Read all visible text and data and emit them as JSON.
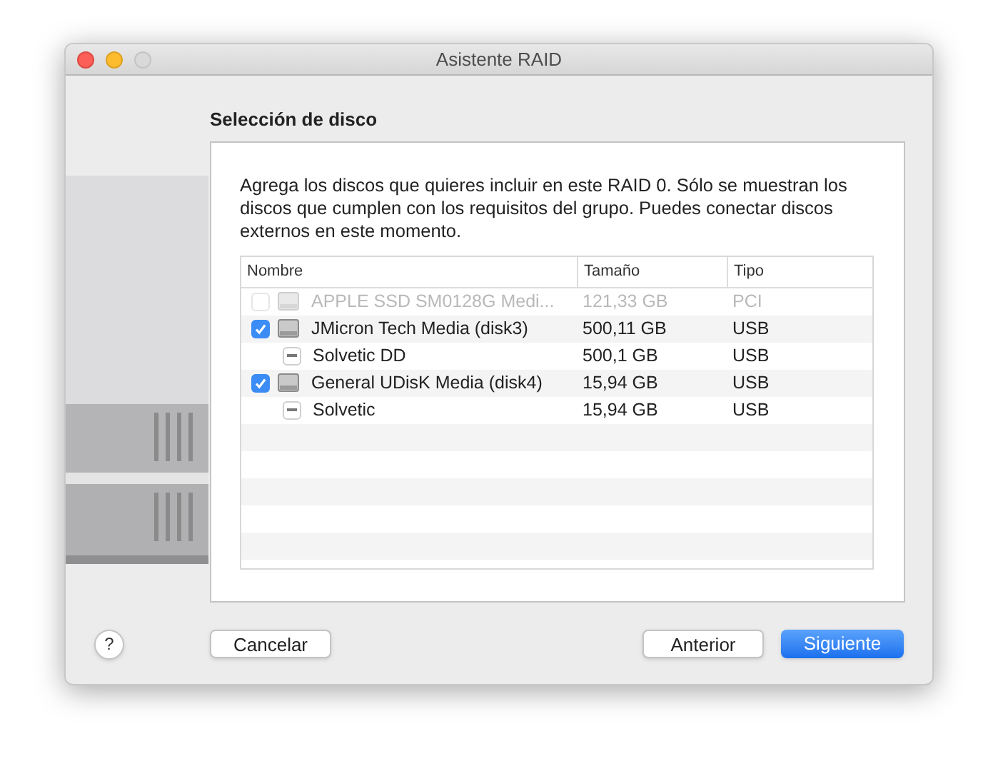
{
  "window": {
    "title": "Asistente RAID"
  },
  "heading": "Selección de disco",
  "description": "Agrega los discos que quieres incluir en este RAID 0. Sólo se muestran los discos que cumplen con los requisitos del grupo. Puedes conectar discos externos en este momento.",
  "table": {
    "columns": [
      "Nombre",
      "Tamaño",
      "Tipo"
    ],
    "rows": [
      {
        "name": "APPLE SSD SM0128G Medi...",
        "size": "121,33 GB",
        "type": "PCI",
        "checked": false,
        "disabled": true
      },
      {
        "name": "JMicron Tech Media (disk3)",
        "size": "500,11 GB",
        "type": "USB",
        "checked": true,
        "disabled": false,
        "children": [
          {
            "name": "Solvetic DD",
            "size": "500,1 GB",
            "type": "USB",
            "mixed": true
          }
        ]
      },
      {
        "name": "General UDisK Media (disk4)",
        "size": "15,94 GB",
        "type": "USB",
        "checked": true,
        "disabled": false,
        "children": [
          {
            "name": "Solvetic",
            "size": "15,94 GB",
            "type": "USB",
            "mixed": true
          }
        ]
      }
    ]
  },
  "buttons": {
    "help": "?",
    "cancel": "Cancelar",
    "back": "Anterior",
    "next": "Siguiente"
  }
}
